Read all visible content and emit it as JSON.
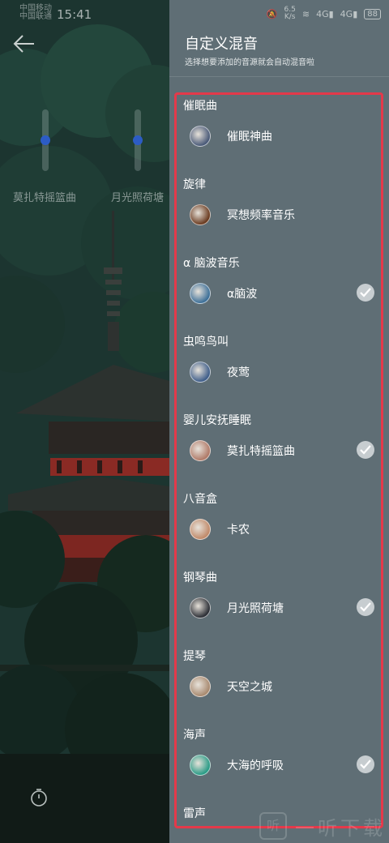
{
  "status_bar": {
    "carrier_line1": "中国移动",
    "carrier_line2": "中国联通",
    "time": "15:41",
    "speed_top": "6.5",
    "speed_bottom": "K/s",
    "signal_1": "4G",
    "signal_2": "4G",
    "battery": "88"
  },
  "background": {
    "slider_1_label": "莫扎特摇篮曲",
    "slider_2_label": "月光照荷塘"
  },
  "drawer": {
    "title": "自定义混音",
    "subtitle": "选择想要添加的音源就会自动混音啦",
    "categories": [
      {
        "label": "催眠曲",
        "item": "催眠神曲",
        "checked": false,
        "thumb_color": "#4a5a78"
      },
      {
        "label": "旋律",
        "item": "冥想频率音乐",
        "checked": false,
        "thumb_color": "#6a3b20"
      },
      {
        "label": "α 脑波音乐",
        "item": "α脑波",
        "checked": true,
        "thumb_color": "#3c6f98"
      },
      {
        "label": "虫鸣鸟叫",
        "item": "夜莺",
        "checked": false,
        "thumb_color": "#3f5e8a"
      },
      {
        "label": "婴儿安抚睡眠",
        "item": "莫扎特摇篮曲",
        "checked": true,
        "thumb_color": "#b07a68"
      },
      {
        "label": "八音盒",
        "item": "卡农",
        "checked": false,
        "thumb_color": "#c08a6a"
      },
      {
        "label": "钢琴曲",
        "item": "月光照荷塘",
        "checked": true,
        "thumb_color": "#2c2f36"
      },
      {
        "label": "提琴",
        "item": "天空之城",
        "checked": false,
        "thumb_color": "#a88a70"
      },
      {
        "label": "海声",
        "item": "大海的呼吸",
        "checked": true,
        "thumb_color": "#2a9b86"
      },
      {
        "label": "雷声"
      }
    ]
  },
  "watermark": {
    "logo": "听",
    "text": "一听下载"
  }
}
